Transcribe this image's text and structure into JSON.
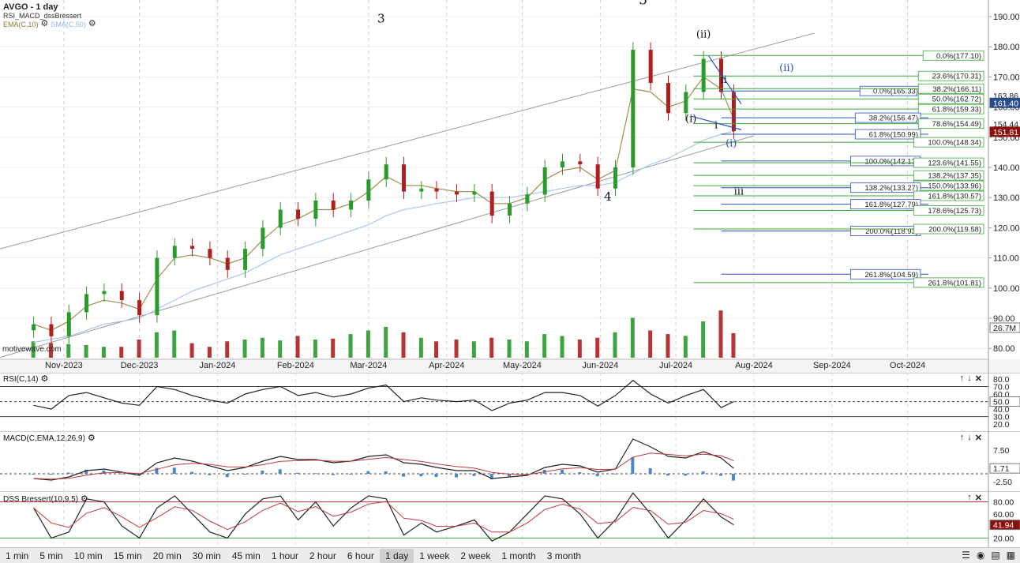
{
  "header": {
    "title": "AVGO - 1 day",
    "study": "RSI_MACD_dssBressert",
    "ema_label": "EMA(C,10)",
    "sma_label": "SMA(C,50)"
  },
  "watermark": "motivewave.com",
  "colors": {
    "up": "#2a9a2a",
    "down": "#b01e1e",
    "ema": "#a09050",
    "sma": "#a8c8ec",
    "fib_green": "#3aaa3a",
    "fib_blue": "#2a50c0",
    "channel": "#999999",
    "price_badge": "#2a4a8a",
    "last_badge": "#8a1010"
  },
  "x_labels": [
    "Nov-2023",
    "Dec-2023",
    "Jan-2024",
    "Feb-2024",
    "Mar-2024",
    "Apr-2024",
    "May-2024",
    "Jun-2024",
    "Jul-2024",
    "Aug-2024",
    "Sep-2024",
    "Oct-2024"
  ],
  "y_labels": [
    "190.00",
    "180.00",
    "170.00",
    "160.00",
    "150.00",
    "140.00",
    "130.00",
    "120.00",
    "110.00",
    "100.00",
    "90.00",
    "80.00"
  ],
  "badges": {
    "price_a": "163.86",
    "price_b": "161.40",
    "price_c": "154.44",
    "price_d": "151.81",
    "volume": "26.7M"
  },
  "wave_labels": [
    "3",
    "4",
    "5",
    "(i)",
    "(ii)",
    "i",
    "ii",
    "iii",
    "(i)",
    "(ii)"
  ],
  "fib_levels": [
    {
      "label": "0.0%(177.10)",
      "price": 177.1,
      "color": "green",
      "start": "2024-07-08"
    },
    {
      "label": "23.6%(170.31)",
      "price": 170.31,
      "color": "green",
      "start": "2024-07-08"
    },
    {
      "label": "0.0%(165.33)",
      "price": 165.33,
      "color": "blue",
      "start": "2024-07-19"
    },
    {
      "label": "38.2%(166.11)",
      "price": 166.11,
      "color": "green",
      "start": "2024-07-08"
    },
    {
      "label": "50.0%(162.72)",
      "price": 162.72,
      "color": "green",
      "start": "2024-07-08"
    },
    {
      "label": "61.8%(159.33)",
      "price": 159.33,
      "color": "green",
      "start": "2024-07-08"
    },
    {
      "label": "38.2%(156.47)",
      "price": 156.47,
      "color": "blue",
      "start": "2024-07-19"
    },
    {
      "label": "78.6%(154.49)",
      "price": 154.49,
      "color": "green",
      "start": "2024-07-08"
    },
    {
      "label": "61.8%(150.99)",
      "price": 150.99,
      "color": "blue",
      "start": "2024-07-19"
    },
    {
      "label": "100.0%(148.34)",
      "price": 148.34,
      "color": "green",
      "start": "2024-07-08"
    },
    {
      "label": "100.0%(142.13)",
      "price": 142.13,
      "color": "blue",
      "start": "2024-07-19"
    },
    {
      "label": "123.6%(141.55)",
      "price": 141.55,
      "color": "green",
      "start": "2024-07-08"
    },
    {
      "label": "138.2%(137.35)",
      "price": 137.35,
      "color": "green",
      "start": "2024-07-08"
    },
    {
      "label": "150.0%(133.96)",
      "price": 133.96,
      "color": "green",
      "start": "2024-07-08"
    },
    {
      "label": "138.2%(133.27)",
      "price": 133.27,
      "color": "blue",
      "start": "2024-07-19"
    },
    {
      "label": "161.8%(130.57)",
      "price": 130.57,
      "color": "green",
      "start": "2024-07-08"
    },
    {
      "label": "161.8%(127.79)",
      "price": 127.79,
      "color": "blue",
      "start": "2024-07-19"
    },
    {
      "label": "178.6%(125.73)",
      "price": 125.73,
      "color": "green",
      "start": "2024-07-08"
    },
    {
      "label": "200.0%(118.93)",
      "price": 118.93,
      "color": "blue",
      "start": "2024-07-19"
    },
    {
      "label": "200.0%(119.58)",
      "price": 119.58,
      "color": "green",
      "start": "2024-07-08"
    },
    {
      "label": "261.8%(104.59)",
      "price": 104.59,
      "color": "blue",
      "start": "2024-07-19"
    },
    {
      "label": "261.8%(101.81)",
      "price": 101.81,
      "color": "green",
      "start": "2024-07-08"
    }
  ],
  "rsi": {
    "label": "RSI(C,14)",
    "y_labels": [
      "80.0",
      "70.0",
      "60.0",
      "50.0",
      "40.0",
      "30.0",
      "20.0"
    ],
    "last": "50.0"
  },
  "macd": {
    "label": "MACD(C,EMA,12,26,9)",
    "y_labels": [
      "7.50",
      "2.50",
      "-2.50"
    ],
    "last": "1.71"
  },
  "dss": {
    "label": "DSS Bressert(10,9,5)",
    "y_labels": [
      "80.00",
      "60.00",
      "40.00",
      "20.00"
    ],
    "last": "41.94"
  },
  "timeframes": [
    "1 min",
    "5 min",
    "10 min",
    "15 min",
    "20 min",
    "30 min",
    "45 min",
    "1 hour",
    "2 hour",
    "6 hour",
    "1 day",
    "1 week",
    "2 week",
    "1 month",
    "3 month"
  ],
  "selected_timeframe": "1 day",
  "chart_data": {
    "type": "candlestick",
    "symbol": "AVGO",
    "interval": "1 day",
    "ylim": [
      76,
      194
    ],
    "x": [
      "2023-10-20",
      "2023-10-27",
      "2023-11-03",
      "2023-11-10",
      "2023-11-17",
      "2023-11-24",
      "2023-12-01",
      "2023-12-08",
      "2023-12-15",
      "2023-12-22",
      "2023-12-29",
      "2024-01-05",
      "2024-01-12",
      "2024-01-19",
      "2024-01-26",
      "2024-02-02",
      "2024-02-09",
      "2024-02-16",
      "2024-02-23",
      "2024-03-01",
      "2024-03-08",
      "2024-03-15",
      "2024-03-22",
      "2024-03-28",
      "2024-04-05",
      "2024-04-12",
      "2024-04-19",
      "2024-04-26",
      "2024-05-03",
      "2024-05-10",
      "2024-05-17",
      "2024-05-24",
      "2024-05-31",
      "2024-06-07",
      "2024-06-14",
      "2024-06-21",
      "2024-06-28",
      "2024-07-05",
      "2024-07-12",
      "2024-07-19",
      "2024-07-24"
    ],
    "close": [
      88,
      84,
      92,
      98,
      99,
      96,
      91,
      110,
      114,
      113,
      110,
      106,
      113,
      120,
      126,
      123,
      129,
      126,
      129,
      136,
      141,
      132,
      133,
      132,
      131,
      132,
      124,
      128,
      131,
      140,
      142,
      141,
      133,
      140,
      179,
      168,
      158,
      165,
      176,
      165,
      152
    ],
    "ema10": [
      88,
      86,
      89,
      94,
      96,
      95,
      93,
      103,
      110,
      111,
      110,
      108,
      110,
      116,
      121,
      123,
      126,
      126,
      128,
      132,
      137,
      134,
      134,
      133,
      132,
      132,
      128,
      128,
      130,
      136,
      139,
      140,
      136,
      139,
      166,
      165,
      160,
      162,
      170,
      166,
      156
    ],
    "sma50": [
      82,
      83,
      84,
      86,
      88,
      89,
      90,
      93,
      96,
      99,
      101,
      103,
      105,
      108,
      111,
      113,
      115,
      117,
      119,
      121,
      124,
      126,
      127,
      128,
      129,
      130,
      130,
      130,
      131,
      132,
      133,
      134,
      134,
      135,
      138,
      141,
      143,
      146,
      149,
      151,
      152
    ],
    "volume_m": [
      18,
      16,
      15,
      14,
      12,
      12,
      20,
      28,
      30,
      16,
      12,
      18,
      20,
      22,
      19,
      24,
      20,
      21,
      26,
      30,
      34,
      28,
      22,
      18,
      20,
      18,
      22,
      20,
      18,
      26,
      24,
      20,
      22,
      28,
      44,
      30,
      26,
      24,
      40,
      52,
      27
    ],
    "rsi": [
      45,
      40,
      58,
      62,
      55,
      48,
      45,
      70,
      66,
      58,
      52,
      48,
      60,
      66,
      70,
      58,
      62,
      56,
      60,
      68,
      72,
      50,
      55,
      52,
      50,
      52,
      38,
      48,
      52,
      62,
      62,
      58,
      44,
      58,
      78,
      60,
      48,
      58,
      66,
      42,
      50
    ],
    "macd": [
      -1.5,
      -2.0,
      -1.0,
      1.0,
      1.5,
      0.5,
      -0.5,
      3.5,
      5.0,
      4.0,
      2.5,
      1.0,
      2.0,
      4.0,
      5.5,
      4.5,
      4.5,
      3.5,
      4.0,
      5.5,
      6.0,
      3.5,
      3.0,
      2.0,
      1.0,
      1.0,
      -1.5,
      -1.0,
      -0.5,
      2.0,
      3.0,
      2.5,
      0.5,
      1.5,
      11.0,
      8.5,
      5.5,
      5.0,
      7.0,
      5.0,
      1.71
    ],
    "dss": [
      70,
      20,
      30,
      85,
      80,
      40,
      20,
      70,
      90,
      60,
      30,
      20,
      60,
      85,
      90,
      50,
      80,
      40,
      70,
      90,
      85,
      25,
      45,
      30,
      40,
      50,
      15,
      30,
      60,
      90,
      85,
      60,
      20,
      50,
      95,
      60,
      20,
      50,
      85,
      55,
      41.94
    ],
    "price_lines": {
      "last": 151.81
    }
  }
}
